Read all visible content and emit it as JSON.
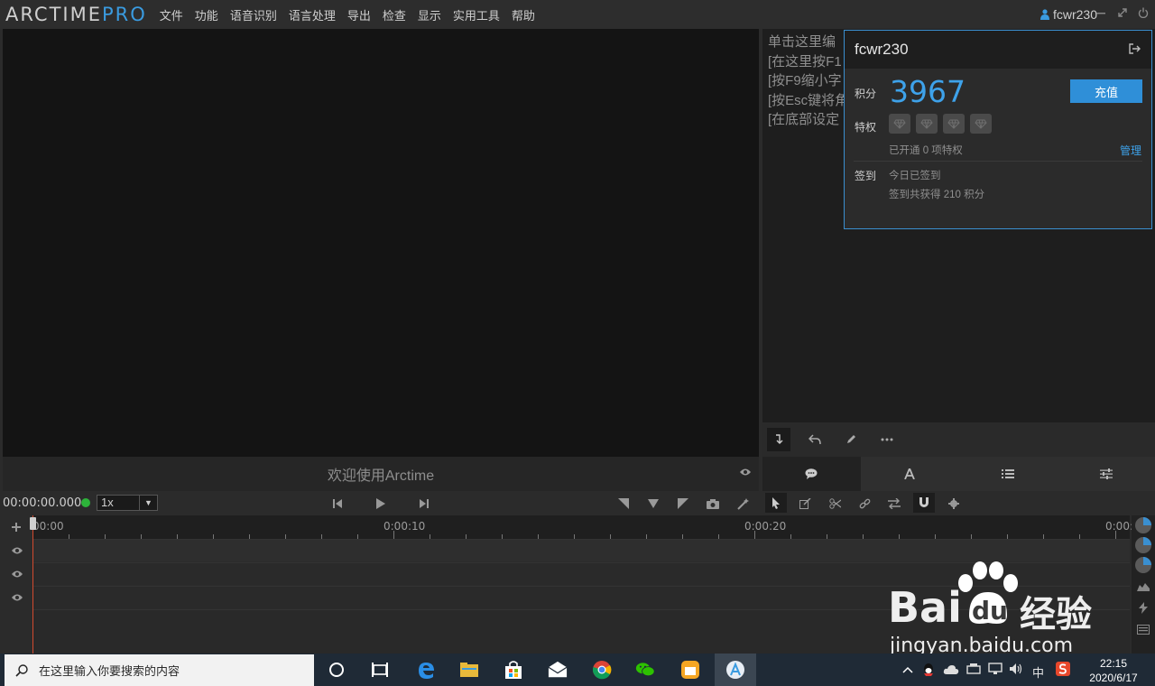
{
  "app": {
    "logo_main": "ARCTIME",
    "logo_pro": "PRO",
    "menu": [
      "文件",
      "功能",
      "语音识别",
      "语言处理",
      "导出",
      "检查",
      "显示",
      "实用工具",
      "帮助"
    ],
    "username": "fcwr230"
  },
  "video": {
    "welcome": "欢迎使用Arctime"
  },
  "subtitle_panel": {
    "lines": [
      "单击这里编",
      "[在这里按F1",
      "[按F9缩小字",
      "[按Esc键将角",
      "[在底部设定"
    ]
  },
  "account_popup": {
    "username": "fcwr230",
    "points_label": "积分",
    "points_value": "3967",
    "recharge_label": "充值",
    "privilege_label": "特权",
    "privilege_status": "已开通 0 项特权",
    "manage_label": "管理",
    "checkin_label": "签到",
    "checkin_today": "今日已签到",
    "checkin_total": "签到共获得 210 积分"
  },
  "transport": {
    "timecode": "00:00:00.000",
    "speed": "1x"
  },
  "timeline": {
    "ruler_labels": [
      "00:00",
      "0:00:10",
      "0:00:20",
      "0:00:"
    ]
  },
  "watermark": {
    "brand": "Bai",
    "du": "du",
    "jingyan": "经验",
    "url": "jingyan.baidu.com"
  },
  "taskbar": {
    "search_placeholder": "在这里输入你要搜索的内容",
    "ime": "中",
    "time": "22:15",
    "date": "2020/6/17"
  },
  "colors": {
    "accent": "#3ea2ea",
    "playhead": "#d24a2e",
    "status_green": "#2db33a"
  }
}
